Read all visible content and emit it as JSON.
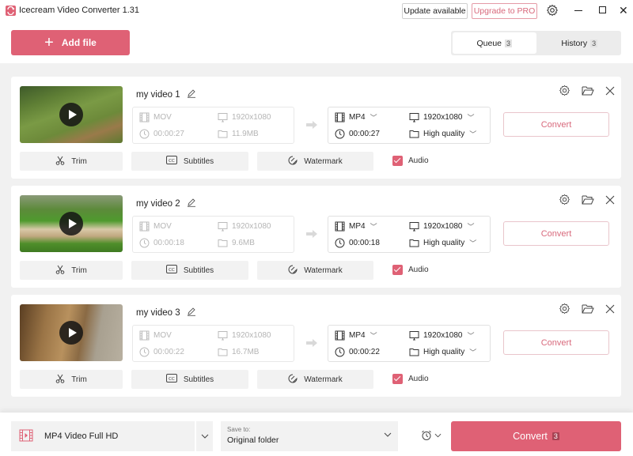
{
  "app": {
    "title": "Icecream Video Converter 1.31",
    "update_label": "Update available",
    "pro_label": "Upgrade to PRO",
    "accent_color": "#df6175"
  },
  "header": {
    "add_file_label": "Add file",
    "tabs": [
      {
        "label": "Queue",
        "count": "3",
        "active": true
      },
      {
        "label": "History",
        "count": "3",
        "active": false
      }
    ]
  },
  "videos": [
    {
      "name": "my video 1",
      "source": {
        "format": "MOV",
        "resolution": "1920x1080",
        "duration": "00:00:27",
        "size": "11.9MB"
      },
      "target": {
        "format": "MP4",
        "resolution": "1920x1080",
        "duration": "00:00:27",
        "quality": "High quality"
      },
      "convert_label": "Convert",
      "options": {
        "trim": "Trim",
        "subtitles": "Subtitles",
        "watermark": "Watermark",
        "audio": "Audio",
        "audio_checked": true
      },
      "thumb": "grassland"
    },
    {
      "name": "my video 2",
      "source": {
        "format": "MOV",
        "resolution": "1920x1080",
        "duration": "00:00:18",
        "size": "9.6MB"
      },
      "target": {
        "format": "MP4",
        "resolution": "1920x1080",
        "duration": "00:00:18",
        "quality": "High quality"
      },
      "convert_label": "Convert",
      "options": {
        "trim": "Trim",
        "subtitles": "Subtitles",
        "watermark": "Watermark",
        "audio": "Audio",
        "audio_checked": true
      },
      "thumb": "cheetah"
    },
    {
      "name": "my video 3",
      "source": {
        "format": "MOV",
        "resolution": "1920x1080",
        "duration": "00:00:22",
        "size": "16.7MB"
      },
      "target": {
        "format": "MP4",
        "resolution": "1920x1080",
        "duration": "00:00:22",
        "quality": "High quality"
      },
      "convert_label": "Convert",
      "options": {
        "trim": "Trim",
        "subtitles": "Subtitles",
        "watermark": "Watermark",
        "audio": "Audio",
        "audio_checked": true
      },
      "thumb": "lion"
    }
  ],
  "footer": {
    "preset": "MP4 Video Full HD",
    "save_to_label": "Save to:",
    "save_to_value": "Original folder",
    "convert_label": "Convert",
    "convert_count": "3"
  }
}
